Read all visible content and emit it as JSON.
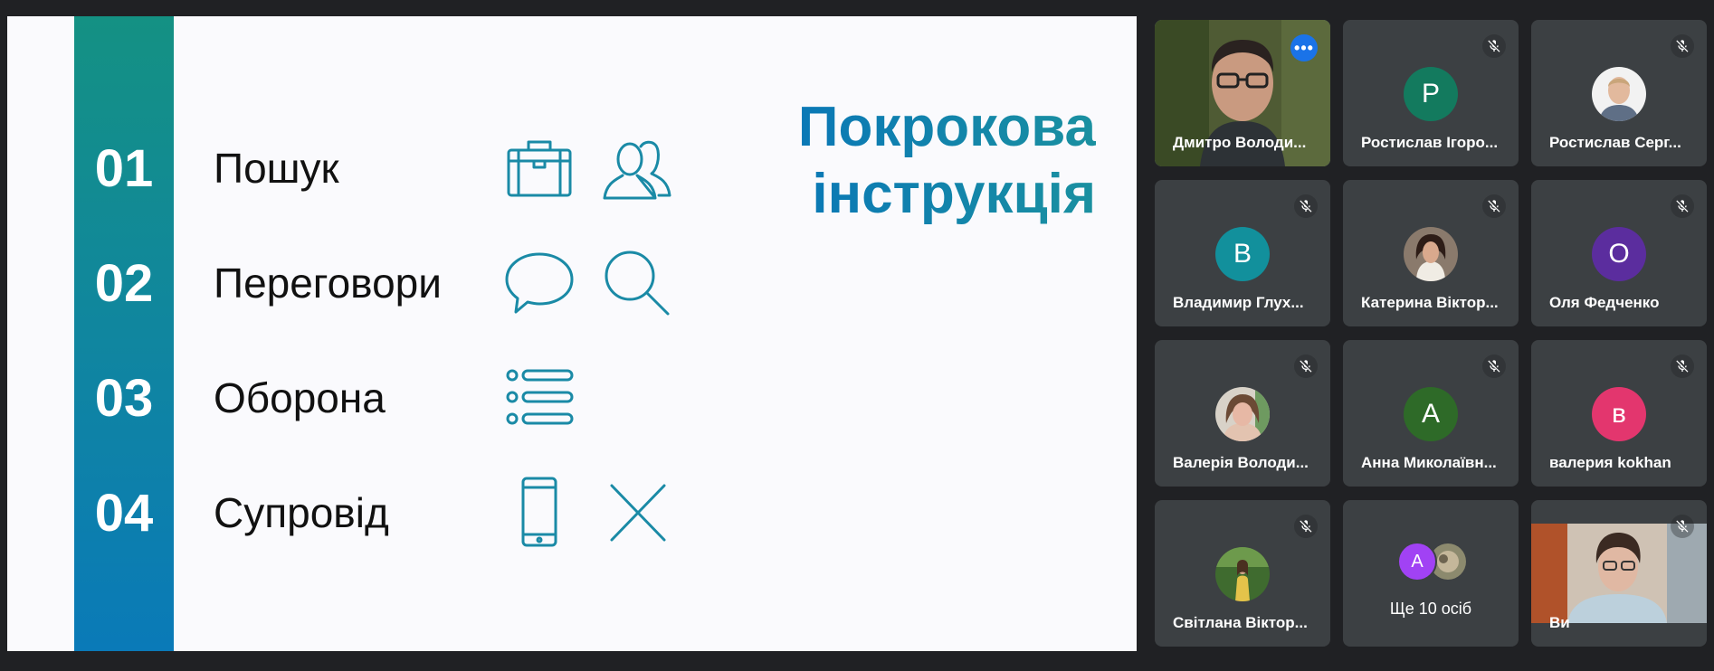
{
  "slide": {
    "title_line1": "Покрокова",
    "title_line2": "інструкція",
    "steps": [
      {
        "number": "01",
        "label": "Пошук",
        "icons": [
          "briefcase-icon",
          "people-icon"
        ]
      },
      {
        "number": "02",
        "label": "Переговори",
        "icons": [
          "speech-bubble-icon",
          "magnifier-icon"
        ]
      },
      {
        "number": "03",
        "label": "Оборона",
        "icons": [
          "list-icon"
        ]
      },
      {
        "number": "04",
        "label": "Супровід",
        "icons": [
          "smartphone-icon",
          "cross-icon"
        ]
      }
    ],
    "colors": {
      "accent_teal": "#149183",
      "accent_blue": "#0a7ab8",
      "icon_stroke": "#1a8aa6"
    }
  },
  "participants": [
    {
      "name": "Дмитро Володи...",
      "avatar_type": "video",
      "muted": false,
      "active_speaker": true
    },
    {
      "name": "Ростислав Ігоро...",
      "avatar_type": "initial",
      "initial": "Р",
      "color": "#137a5e",
      "muted": true
    },
    {
      "name": "Ростислав Серг...",
      "avatar_type": "photo",
      "muted": true
    },
    {
      "name": "Владимир Глух...",
      "avatar_type": "initial",
      "initial": "В",
      "color": "#12909c",
      "muted": true
    },
    {
      "name": "Катерина Віктор...",
      "avatar_type": "photo",
      "muted": true
    },
    {
      "name": "Оля Федченко",
      "avatar_type": "initial",
      "initial": "О",
      "color": "#5b2d9e",
      "muted": true
    },
    {
      "name": "Валерія Володи...",
      "avatar_type": "photo",
      "muted": true
    },
    {
      "name": "Анна Миколаївн...",
      "avatar_type": "initial",
      "initial": "А",
      "color": "#2e6a28",
      "muted": true
    },
    {
      "name": "валерия kokhan",
      "avatar_type": "initial",
      "initial": "в",
      "color": "#e3366e",
      "muted": true
    },
    {
      "name": "Світлана Віктор...",
      "avatar_type": "photo",
      "muted": true
    },
    {
      "name": "Ще 10 осіб",
      "avatar_type": "overflow",
      "initial": "А",
      "color": "#a142f4"
    },
    {
      "name": "Ви",
      "avatar_type": "video",
      "muted": true
    }
  ],
  "ui_colors": {
    "background": "#202124",
    "tile": "#3c4043",
    "active_outline": "#8ab4f8",
    "more_button": "#1a73e8"
  }
}
